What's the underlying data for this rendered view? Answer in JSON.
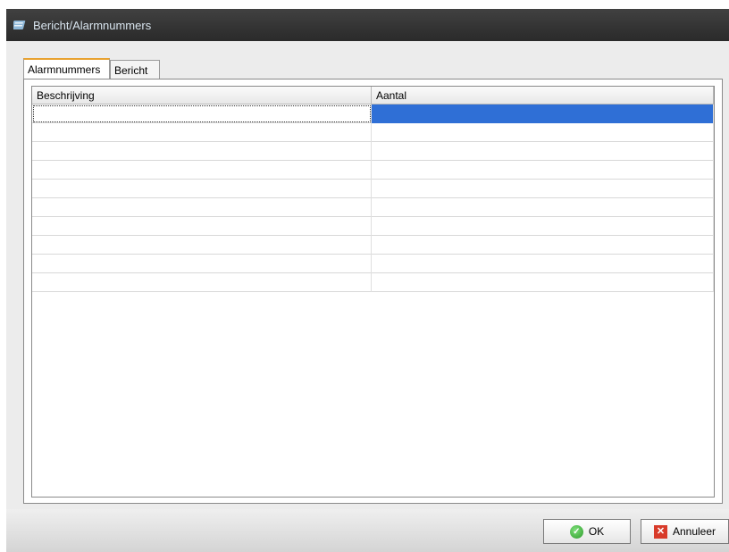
{
  "window": {
    "title": "Bericht/Alarmnummers",
    "title_icon": "notepad-icon"
  },
  "tabs": [
    {
      "label": "Alarmnummers",
      "active": true
    },
    {
      "label": "Bericht",
      "active": false
    }
  ],
  "grid": {
    "columns": [
      "Beschrijving",
      "Aantal"
    ],
    "rows": [
      [
        "",
        ""
      ],
      [
        "",
        ""
      ],
      [
        "",
        ""
      ],
      [
        "",
        ""
      ],
      [
        "",
        ""
      ],
      [
        "",
        ""
      ],
      [
        "",
        ""
      ],
      [
        "",
        ""
      ],
      [
        "",
        ""
      ],
      [
        "",
        ""
      ]
    ],
    "selection_color": "#2f6fd6"
  },
  "buttons": {
    "ok_label": "OK",
    "cancel_label": "Annuleer"
  }
}
